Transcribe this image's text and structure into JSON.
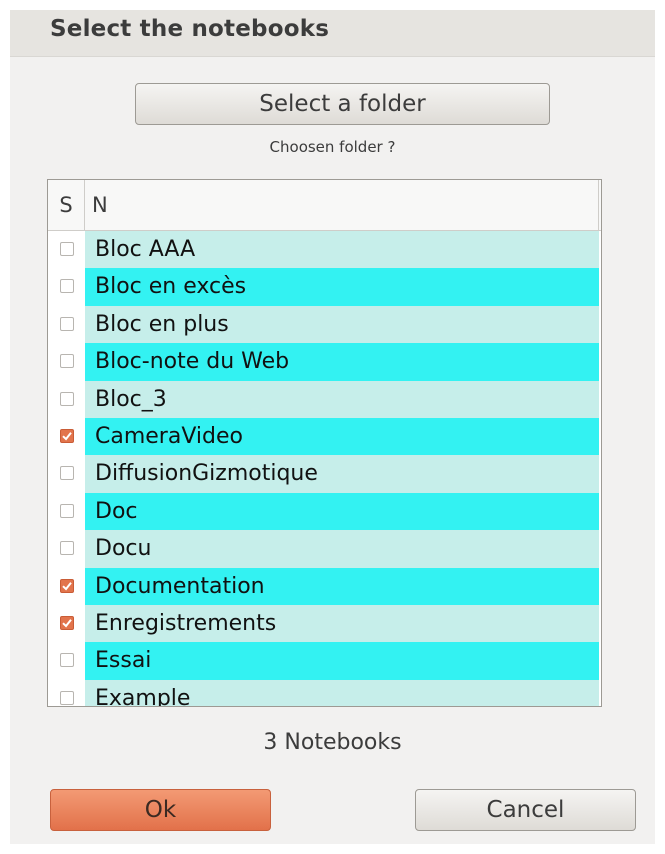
{
  "dialog": {
    "title": "Select the notebooks",
    "select_folder_label": "Select a folder",
    "chosen_folder_text": "Choosen folder ?",
    "count_text": "3 Notebooks",
    "ok_label": "Ok",
    "cancel_label": "Cancel"
  },
  "table": {
    "col_select": "S",
    "col_name": "N",
    "rows": [
      {
        "name": "Bloc AAA",
        "checked": false
      },
      {
        "name": "Bloc en excès",
        "checked": false
      },
      {
        "name": "Bloc en plus",
        "checked": false
      },
      {
        "name": "Bloc-note du Web",
        "checked": false
      },
      {
        "name": "Bloc_3",
        "checked": false
      },
      {
        "name": "CameraVideo",
        "checked": true
      },
      {
        "name": "DiffusionGizmotique",
        "checked": false
      },
      {
        "name": "Doc",
        "checked": false
      },
      {
        "name": "Docu",
        "checked": false
      },
      {
        "name": "Documentation",
        "checked": true
      },
      {
        "name": "Enregistrements",
        "checked": true
      },
      {
        "name": "Essai",
        "checked": false
      },
      {
        "name": "Example",
        "checked": false
      }
    ]
  },
  "colors": {
    "accent": "#e2744c",
    "row_light": "#c6eeea",
    "row_cyan": "#33f2f2"
  }
}
